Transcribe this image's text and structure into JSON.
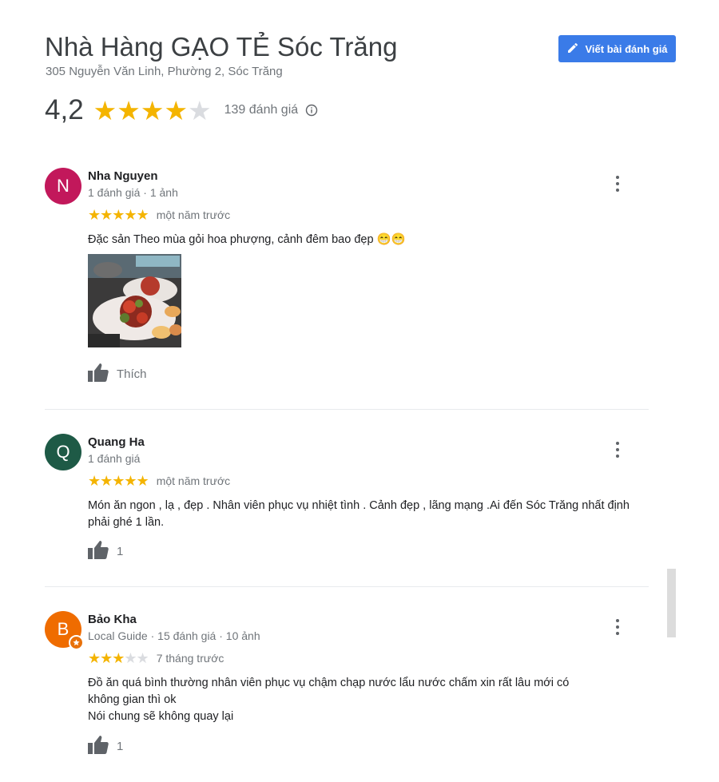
{
  "place": {
    "title": "Nhà Hàng GẠO TẺ Sóc Trăng",
    "address": "305 Nguyễn Văn Linh, Phường 2, Sóc Trăng",
    "rating": "4,2",
    "rating_value": 4.2,
    "review_count": "139 đánh giá"
  },
  "write_review_label": "Viết bài đánh giá",
  "colors": {
    "accent": "#3a7be8",
    "star": "#f4b400",
    "star_empty": "#dadce0"
  },
  "reviews": [
    {
      "avatar_letter": "N",
      "avatar_color": "#c2185b",
      "name": "Nha Nguyen",
      "meta": "1 đánh giá · 1 ảnh",
      "stars": 5,
      "time": "một năm trước",
      "text": "Đặc sản Theo mùa gỏi hoa phượng, cảnh đêm bao đẹp 😁😁",
      "like_label": "Thích"
    },
    {
      "avatar_letter": "Q",
      "avatar_color": "#1e5a46",
      "name": "Quang Ha",
      "meta": "1 đánh giá",
      "stars": 5,
      "time": "một năm trước",
      "text": "Món ăn ngon , lạ , đẹp . Nhân viên phục vụ nhiệt tình . Cảnh đẹp , lãng mạng .Ai đến Sóc Trăng nhất định phải ghé 1 lần.",
      "like_label": "1"
    },
    {
      "avatar_letter": "B",
      "avatar_color": "#ef6c00",
      "name": "Bảo Kha",
      "meta": "Local Guide · 15 đánh giá · 10 ảnh",
      "stars": 3,
      "time": "7 tháng trước",
      "text_line1": "Đồ ăn quá bình thường nhân viên phục vụ chậm chạp nước lẩu nước chấm xin rất lâu mới có không gian thì ok",
      "text_line2": "Nói chung sẽ không quay lại",
      "like_label": "1"
    }
  ]
}
